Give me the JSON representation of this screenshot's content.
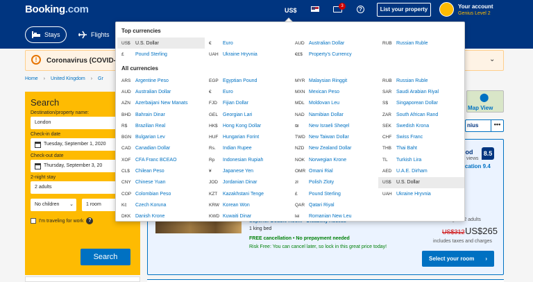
{
  "header": {
    "logo_main": "Booking",
    "logo_dot": ".com",
    "currency": "US$",
    "mail_badge": "3",
    "help_glyph": "?",
    "list_property": "List your property",
    "account_title": "Your account",
    "account_sub": "Genius Level 2",
    "nav": [
      {
        "label": "Stays",
        "icon": "bed-icon"
      },
      {
        "label": "Flights",
        "icon": "plane-icon"
      }
    ]
  },
  "banner": {
    "icon_glyph": "!",
    "text": "Coronavirus (COVID-1",
    "chevron": "⌄"
  },
  "breadcrumb": [
    "Home",
    "›",
    "United Kingdom",
    "›",
    "Gr"
  ],
  "search": {
    "title": "Search",
    "destination_label": "Destination/property name:",
    "destination_value": "London",
    "checkin_label": "Check-in date",
    "checkin_value": "Tuesday, September 1, 2020",
    "checkout_label": "Check-out date",
    "checkout_value": "Thursday, September 3, 20",
    "stay_label": "2-night stay",
    "adults": "2 adults",
    "children": "No children",
    "rooms": "1 room",
    "work_label": "I'm traveling for work",
    "button": "Search"
  },
  "map": {
    "label": "Map View"
  },
  "genius_pill": {
    "text": "nius",
    "dots": "•••"
  },
  "result": {
    "rating_word": "ood",
    "reviews": "views",
    "score": "8.5",
    "location": "ocation 9.4",
    "room_title": "Superior Double Room - Disability Access",
    "bed": "1 king bed",
    "free_cancel": "FREE cancellation • No prepayment needed",
    "risk_free": "Risk Free: You can cancel later, so lock in this great price today!",
    "nights": "2 nights, 2 adults",
    "old_price": "US$312",
    "new_price": "US$265",
    "taxes": "includes taxes and charges",
    "room_button": "Select your room",
    "room_button_arrow": "›"
  },
  "currency_dropdown": {
    "top_heading": "Top currencies",
    "all_heading": "All currencies",
    "top": [
      {
        "code": "US$",
        "name": "U.S. Dollar",
        "selected": true
      },
      {
        "code": "€",
        "name": "Euro"
      },
      {
        "code": "AUD",
        "name": "Australian Dollar"
      },
      {
        "code": "RUB",
        "name": "Russian Ruble"
      },
      {
        "code": "£",
        "name": "Pound Sterling"
      },
      {
        "code": "UAH",
        "name": "Ukraine Hryvnia"
      },
      {
        "code": "€£$",
        "name": "Property's Currency"
      }
    ],
    "all": [
      {
        "code": "ARS",
        "name": "Argentine Peso"
      },
      {
        "code": "EGP",
        "name": "Egyptian Pound"
      },
      {
        "code": "MYR",
        "name": "Malaysian Ringgit"
      },
      {
        "code": "RUB",
        "name": "Russian Ruble"
      },
      {
        "code": "AUD",
        "name": "Australian Dollar"
      },
      {
        "code": "€",
        "name": "Euro"
      },
      {
        "code": "MXN",
        "name": "Mexican Peso"
      },
      {
        "code": "SAR",
        "name": "Saudi Arabian Riyal"
      },
      {
        "code": "AZN",
        "name": "Azerbaijani New Manats"
      },
      {
        "code": "FJD",
        "name": "Fijian Dollar"
      },
      {
        "code": "MDL",
        "name": "Moldovan Leu"
      },
      {
        "code": "S$",
        "name": "Singaporean Dollar"
      },
      {
        "code": "BHD",
        "name": "Bahrain Dinar"
      },
      {
        "code": "GEL",
        "name": "Georgian Lari"
      },
      {
        "code": "NAD",
        "name": "Namibian Dollar"
      },
      {
        "code": "ZAR",
        "name": "South African Rand"
      },
      {
        "code": "R$",
        "name": "Brazilian Real"
      },
      {
        "code": "HK$",
        "name": "Hong Kong Dollar"
      },
      {
        "code": "₪",
        "name": "New Israeli Sheqel"
      },
      {
        "code": "SEK",
        "name": "Swedish Krona"
      },
      {
        "code": "BGN",
        "name": "Bulgarian Lev"
      },
      {
        "code": "HUF",
        "name": "Hungarian Forint"
      },
      {
        "code": "TWD",
        "name": "New Taiwan Dollar"
      },
      {
        "code": "CHF",
        "name": "Swiss Franc"
      },
      {
        "code": "CAD",
        "name": "Canadian Dollar"
      },
      {
        "code": "Rs.",
        "name": "Indian Rupee"
      },
      {
        "code": "NZD",
        "name": "New Zealand Dollar"
      },
      {
        "code": "THB",
        "name": "Thai Baht"
      },
      {
        "code": "XOF",
        "name": "CFA Franc BCEAO"
      },
      {
        "code": "Rp",
        "name": "Indonesian Rupiah"
      },
      {
        "code": "NOK",
        "name": "Norwegian Krone"
      },
      {
        "code": "TL",
        "name": "Turkish Lira"
      },
      {
        "code": "CL$",
        "name": "Chilean Peso"
      },
      {
        "code": "¥",
        "name": "Japanese Yen"
      },
      {
        "code": "OMR",
        "name": "Omani Rial"
      },
      {
        "code": "AED",
        "name": "U.A.E. Dirham"
      },
      {
        "code": "CNY",
        "name": "Chinese Yuan"
      },
      {
        "code": "JOD",
        "name": "Jordanian Dinar"
      },
      {
        "code": "zł",
        "name": "Polish Zloty"
      },
      {
        "code": "US$",
        "name": "U.S. Dollar",
        "selected": true
      },
      {
        "code": "COP",
        "name": "Colombian Peso"
      },
      {
        "code": "KZT",
        "name": "Kazakhstani Tenge"
      },
      {
        "code": "£",
        "name": "Pound Sterling"
      },
      {
        "code": "UAH",
        "name": "Ukraine Hryvnia"
      },
      {
        "code": "Kč",
        "name": "Czech Koruna"
      },
      {
        "code": "KRW",
        "name": "Korean Won"
      },
      {
        "code": "QAR",
        "name": "Qatari Riyal"
      },
      {
        "code": "",
        "name": ""
      },
      {
        "code": "DKK",
        "name": "Danish Krone"
      },
      {
        "code": "KWD",
        "name": "Kuwaiti Dinar"
      },
      {
        "code": "lei",
        "name": "Romanian New Leu"
      },
      {
        "code": "",
        "name": ""
      }
    ]
  }
}
